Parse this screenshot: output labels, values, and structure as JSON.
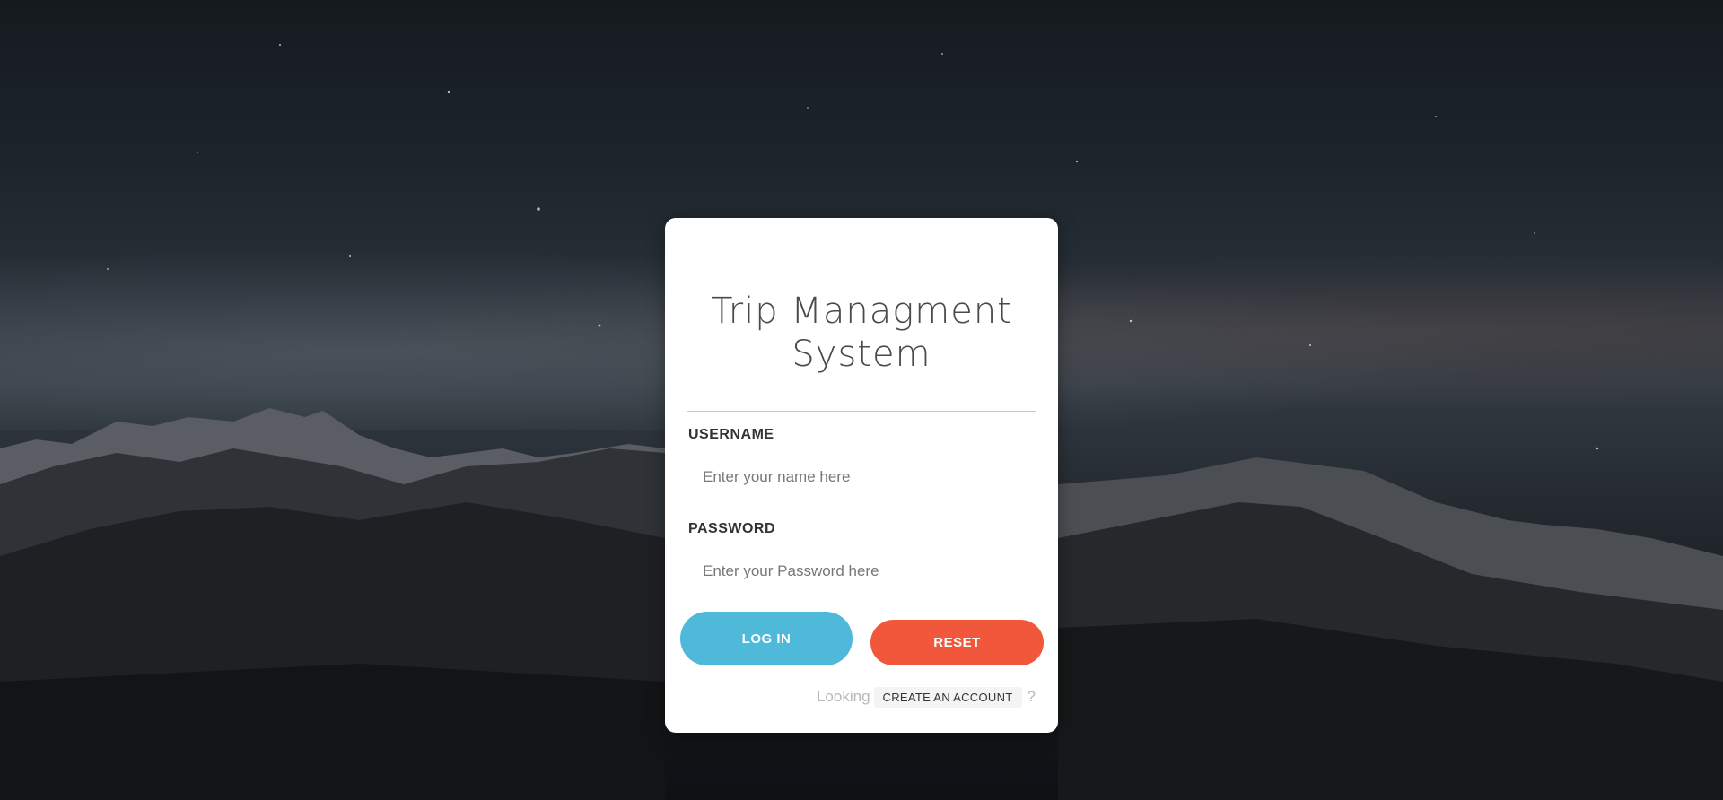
{
  "app": {
    "title_line1": "Trip Managment",
    "title_line2": "System"
  },
  "form": {
    "username_label": "USERNAME",
    "username_placeholder": "Enter your name here",
    "password_label": "PASSWORD",
    "password_placeholder": "Enter your Password here",
    "login_label": "LOG IN",
    "reset_label": "RESET"
  },
  "footer": {
    "prefix": "Looking",
    "create_account_label": "CREATE AN ACCOUNT",
    "suffix": "?"
  },
  "colors": {
    "login_button": "#4fb9da",
    "reset_button": "#f0573b",
    "card_background": "#ffffff"
  }
}
